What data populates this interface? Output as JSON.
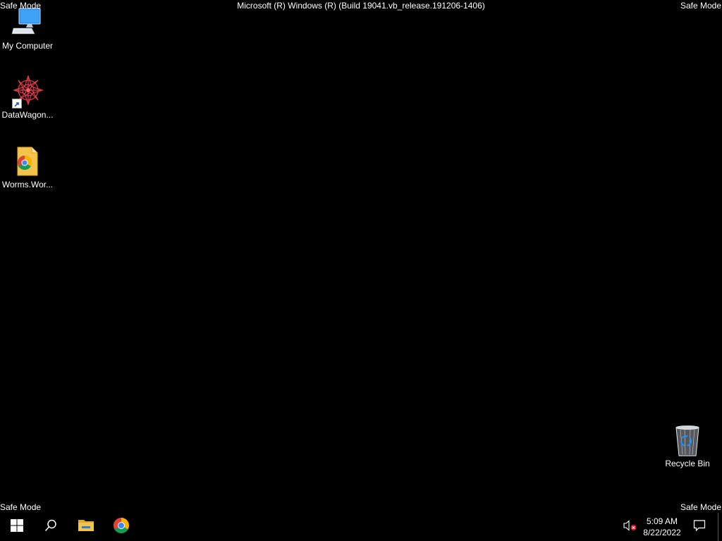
{
  "watermark": {
    "top_left": "Safe Mode",
    "top_right": "Safe Mode",
    "bottom_left": "Safe Mode",
    "bottom_right": "Safe Mode",
    "build": "Microsoft (R) Windows (R) (Build 19041.vb_release.191206-1406)"
  },
  "desktop": {
    "icons": [
      {
        "label": "My Computer",
        "icon": "computer-icon"
      },
      {
        "label": "DataWagon...",
        "icon": "datawagon-icon"
      },
      {
        "label": "Worms.Wor...",
        "icon": "chrome-document-icon"
      },
      {
        "label": "Recycle Bin",
        "icon": "recycle-bin-icon"
      }
    ]
  },
  "taskbar": {
    "buttons": [
      "start-icon",
      "search-icon",
      "file-explorer-icon",
      "chrome-icon"
    ],
    "tray": {
      "volume_icon": "volume-muted-icon",
      "time": "5:09 AM",
      "date": "8/22/2022",
      "notification_icon": "action-center-icon"
    }
  },
  "colors": {
    "background": "#000000",
    "text": "#ffffff",
    "windows_blue": "#2d8ceb",
    "folder_yellow": "#f3c44b"
  }
}
